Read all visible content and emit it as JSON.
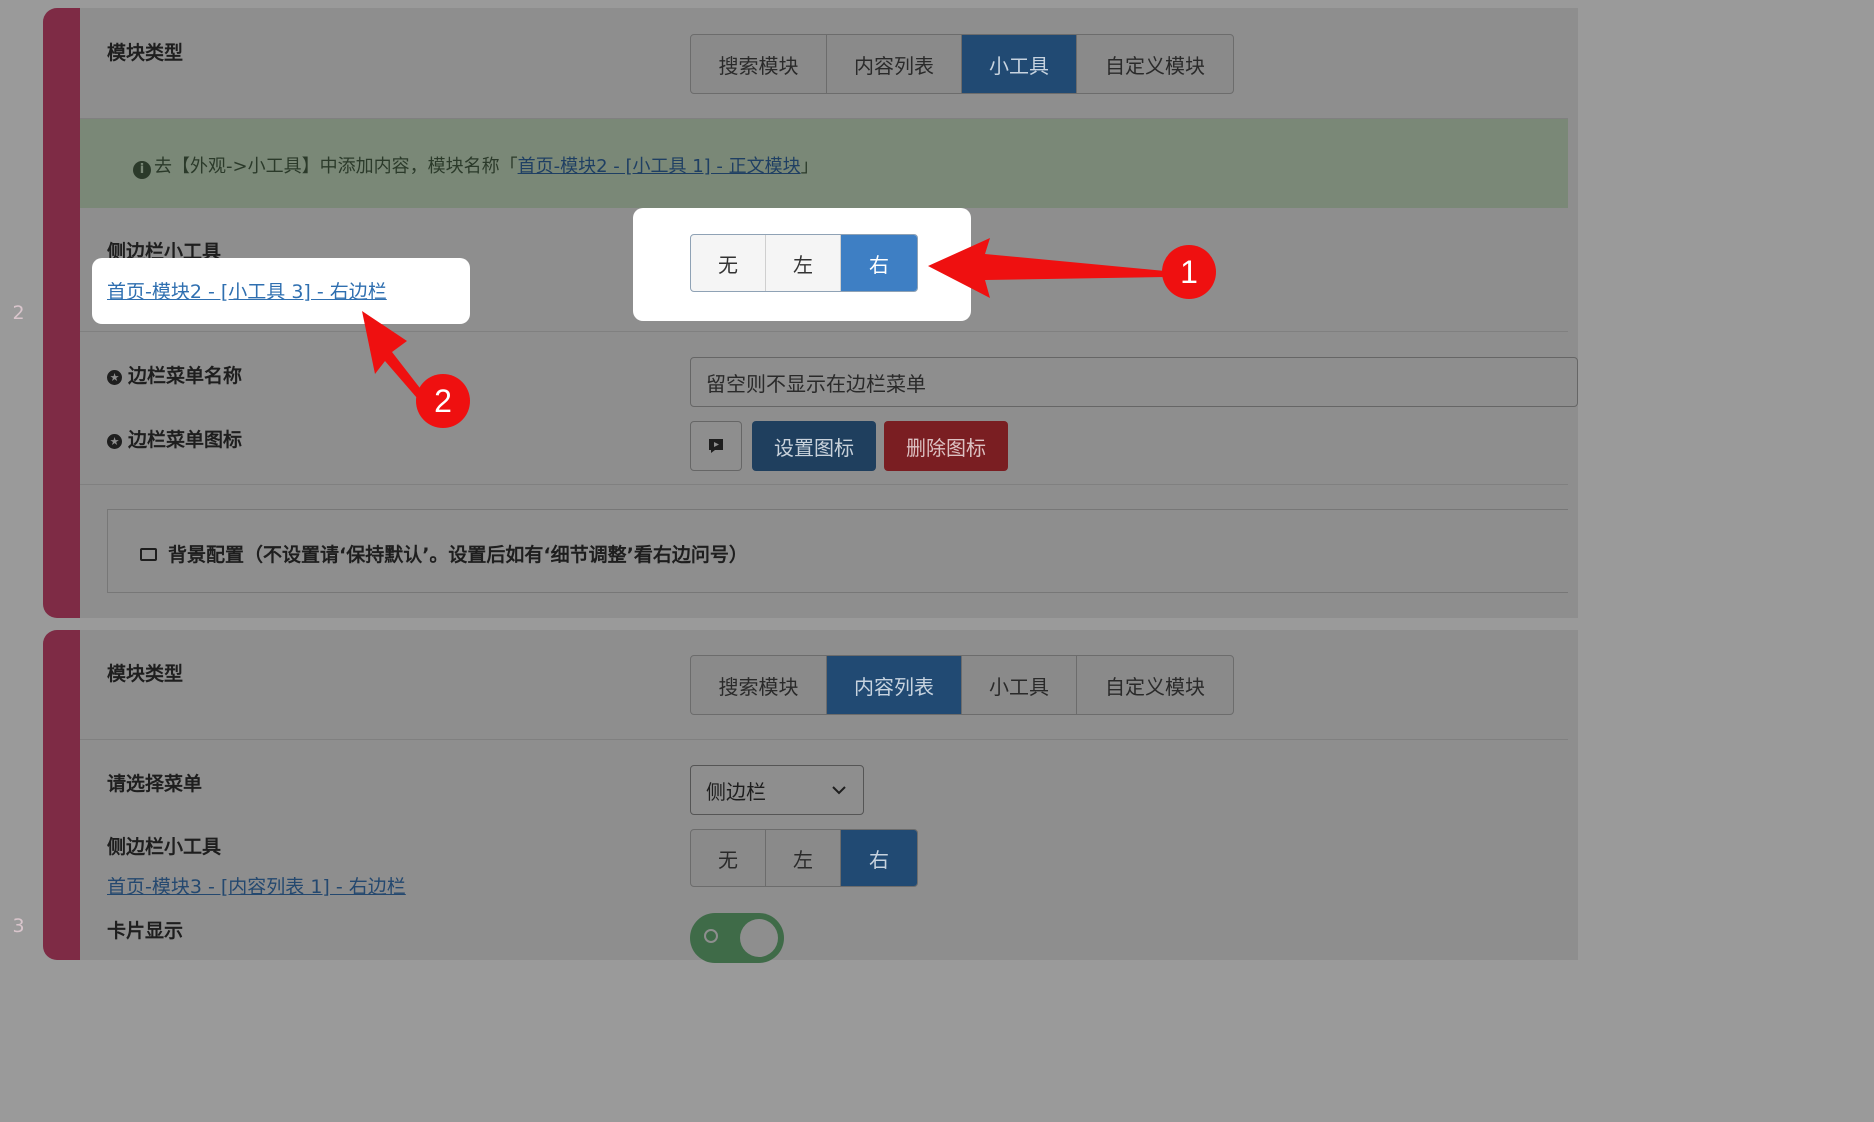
{
  "module2": {
    "number": "2",
    "type_label": "模块类型",
    "type_options": [
      "搜索模块",
      "内容列表",
      "小工具",
      "自定义模块"
    ],
    "type_selected": "小工具",
    "notice": {
      "prefix": "去【外观->小工具】中添加内容，模块名称「",
      "link": "首页-模块2 - [小工具 1] - 正文模块",
      "suffix": "」"
    },
    "sidebar_label": "侧边栏小工具",
    "sidebar_link": "首页-模块2 - [小工具 3] - 右边栏",
    "sidebar_options": [
      "无",
      "左",
      "右"
    ],
    "sidebar_selected": "右",
    "menu_name_label": "边栏菜单名称",
    "menu_name_placeholder": "留空则不显示在边栏菜单",
    "menu_icon_label": "边栏菜单图标",
    "set_icon_button": "设置图标",
    "delete_icon_button": "删除图标",
    "background_config": "背景配置（不设置请‘保持默认’。设置后如有‘细节调整’看右边问号）"
  },
  "module3": {
    "number": "3",
    "type_label": "模块类型",
    "type_options": [
      "搜索模块",
      "内容列表",
      "小工具",
      "自定义模块"
    ],
    "type_selected": "内容列表",
    "menu_select_label": "请选择菜单",
    "menu_select_value": "侧边栏",
    "sidebar_label": "侧边栏小工具",
    "sidebar_link": "首页-模块3 - [内容列表 1] - 右边栏",
    "sidebar_options": [
      "无",
      "左",
      "右"
    ],
    "sidebar_selected": "右",
    "card_display_label": "卡片显示",
    "card_display_on": true
  },
  "annotations": {
    "badge1": "1",
    "badge2": "2",
    "color": "#ef1010"
  }
}
